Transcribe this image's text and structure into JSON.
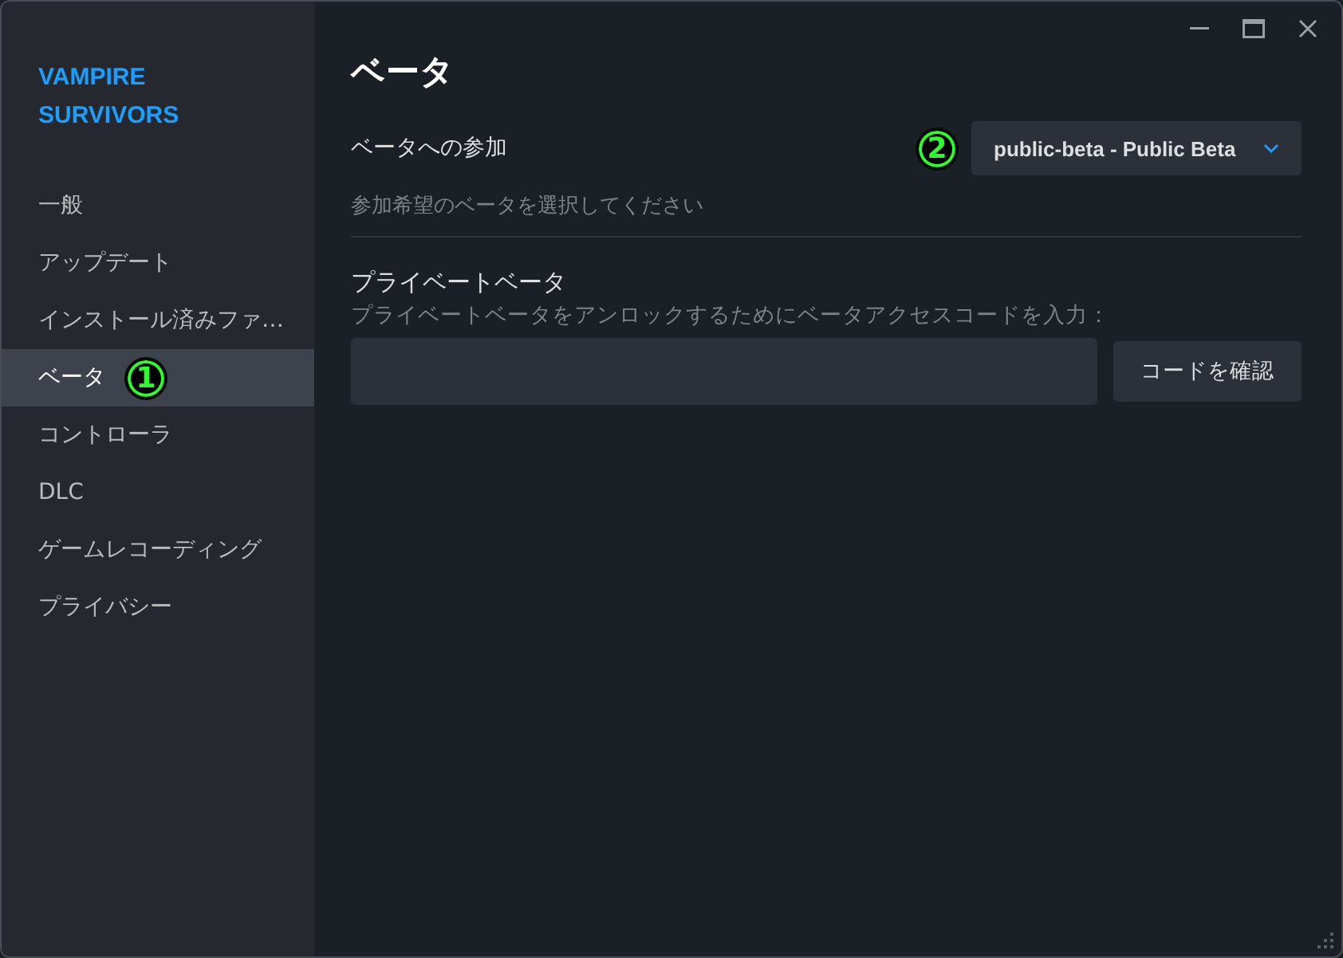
{
  "sidebar": {
    "game_title": "VAMPIRE SURVIVORS",
    "items": [
      {
        "label": "一般",
        "selected": false
      },
      {
        "label": "アップデート",
        "selected": false
      },
      {
        "label": "インストール済みファ…",
        "selected": false
      },
      {
        "label": "ベータ",
        "selected": true,
        "callout": "1"
      },
      {
        "label": "コントローラ",
        "selected": false
      },
      {
        "label": "DLC",
        "selected": false
      },
      {
        "label": "ゲームレコーディング",
        "selected": false
      },
      {
        "label": "プライバシー",
        "selected": false
      }
    ]
  },
  "page": {
    "title": "ベータ",
    "beta_participation": {
      "label": "ベータへの参加",
      "callout": "2",
      "dropdown": {
        "value": "public-beta - Public Beta"
      },
      "description": "参加希望のベータを選択してください"
    },
    "private_beta": {
      "title": "プライベートベータ",
      "description": "プライベートベータをアンロックするためにベータアクセスコードを入力：",
      "button": "コードを確認"
    }
  }
}
